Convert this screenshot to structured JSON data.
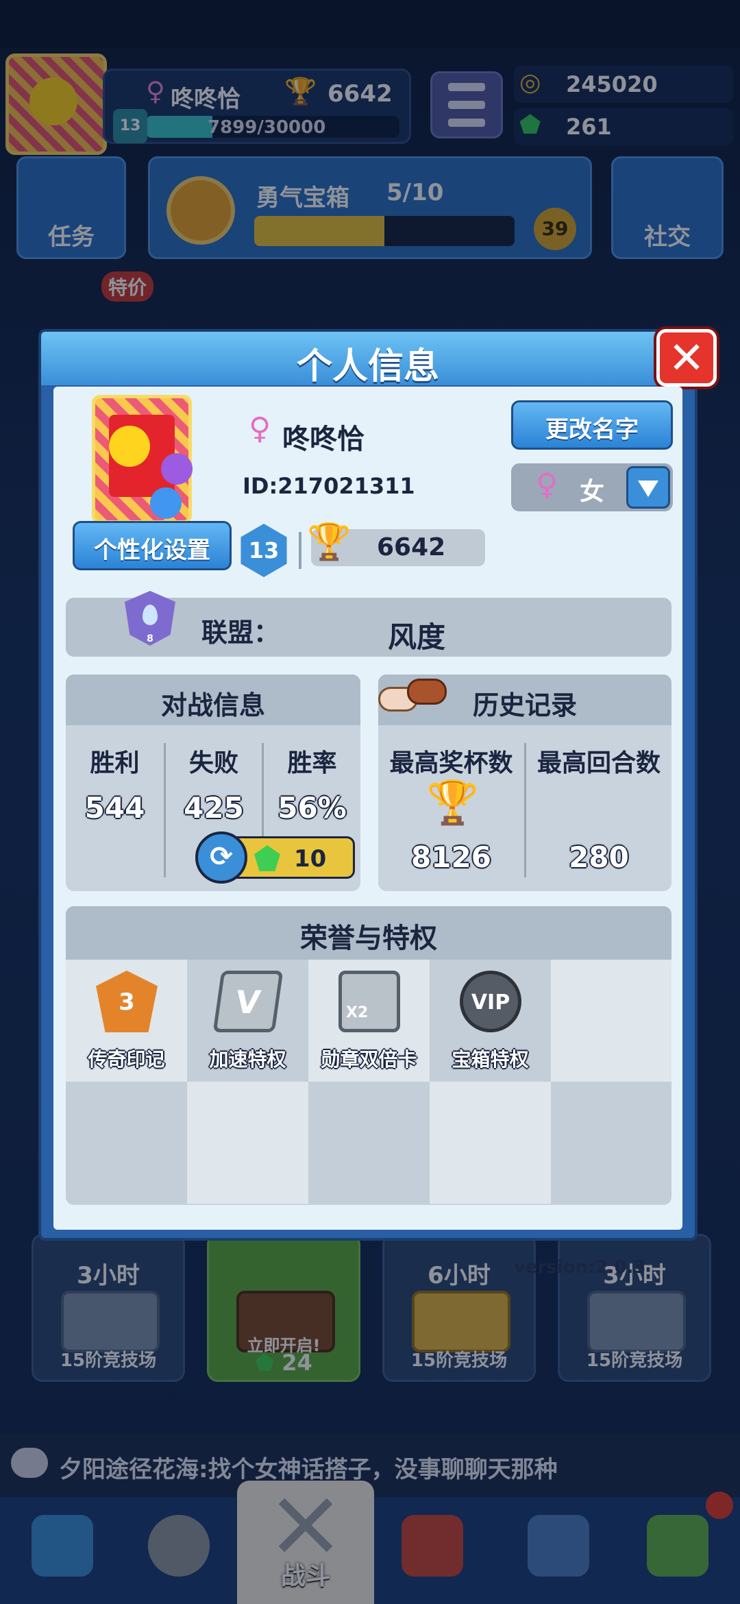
{
  "hud": {
    "player_name": "咚咚恰",
    "trophies": "6642",
    "level": "13",
    "xp_text": "7899/30000",
    "xp_fraction": 0.263,
    "gold": "245020",
    "gems": "261"
  },
  "buttons": {
    "task_label": "任务",
    "social_label": "社交"
  },
  "chest_progress": {
    "title": "勇气宝箱",
    "count": "5/10",
    "fraction": 0.5,
    "badge": "39"
  },
  "side_badges": {
    "special_offer": "特价"
  },
  "modal": {
    "title": "个人信息",
    "close_symbol": "✕",
    "player_name": "咚咚恰",
    "female_symbol": "♀",
    "player_id": "ID:217021311",
    "customize_label": "个性化设置",
    "level": "13",
    "trophies": "6642",
    "rename_label": "更改名字",
    "gender_value": "女",
    "alliance_label": "联盟：",
    "alliance_name": "风度",
    "alliance_level": "8",
    "battle_info": {
      "title": "对战信息",
      "wins_label": "胜利",
      "wins_value": "544",
      "losses_label": "失败",
      "losses_value": "425",
      "rate_label": "胜率",
      "rate_value": "56%",
      "refresh_cost": "10"
    },
    "history": {
      "title": "历史记录",
      "max_trophies_label": "最高奖杯数",
      "max_trophies_value": "8126",
      "max_rounds_label": "最高回合数",
      "max_rounds_value": "280"
    },
    "honors": {
      "title": "荣誉与特权",
      "items": [
        {
          "label": "传奇印记",
          "badge": "3",
          "icon": "legend-badge-icon"
        },
        {
          "label": "加速特权",
          "badge": "V",
          "icon": "speed-card-icon"
        },
        {
          "label": "勋章双倍卡",
          "badge": "X2",
          "icon": "medal-double-card-icon"
        },
        {
          "label": "宝箱特权",
          "badge": "VIP",
          "icon": "vip-icon"
        }
      ]
    },
    "version": "version:2.0.3"
  },
  "chests": [
    {
      "time": "3小时",
      "arena": "15阶竞技场",
      "style": "silver"
    },
    {
      "open_label": "立即开启!",
      "cost": "24",
      "style": "open"
    },
    {
      "time": "6小时",
      "arena": "15阶竞技场",
      "style": "gold"
    },
    {
      "time": "3小时",
      "arena": "15阶竞技场",
      "style": "silver"
    }
  ],
  "chat": {
    "message": "夕阳途径花海:找个女神话搭子，没事聊聊天那种"
  },
  "nav": {
    "battle_label": "战斗"
  }
}
